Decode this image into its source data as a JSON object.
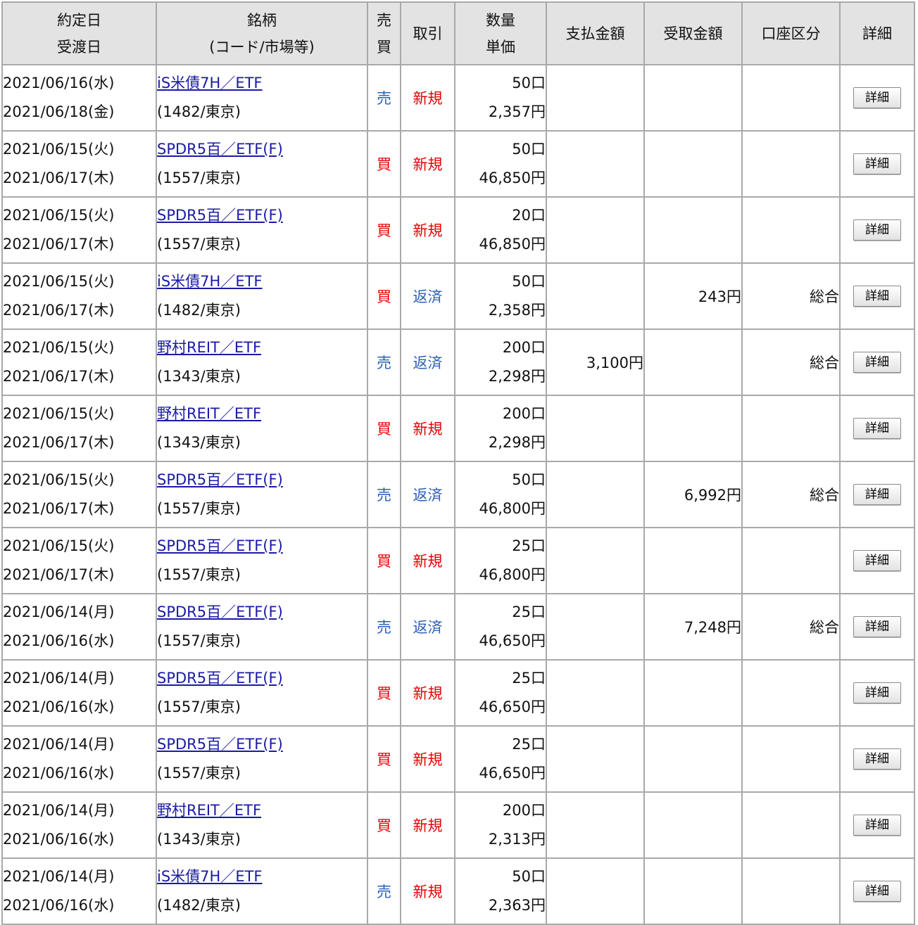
{
  "header": {
    "col1": [
      "約定日",
      "受渡日"
    ],
    "col2": [
      "銘柄",
      "(コード/市場等)"
    ],
    "col3": [
      "売",
      "買"
    ],
    "col4": "取引",
    "col5": [
      "数量",
      "単価"
    ],
    "col6": "支払金額",
    "col7": "受取金額",
    "col8": "口座区分",
    "col9": "詳細"
  },
  "detail_button_label": "詳細",
  "colors": {
    "sell": "#2a5fb7",
    "buy": "#e60000",
    "new": "#e60000",
    "close": "#2a5fb7"
  },
  "rows": [
    {
      "trade_date": "2021/06/16(水)",
      "settle_date": "2021/06/18(金)",
      "name": "iS米債7H／ETF",
      "code": "(1482/東京)",
      "side": "売",
      "kind": "新規",
      "qty": "50口",
      "price": "2,357円",
      "pay": "",
      "receive": "",
      "account": ""
    },
    {
      "trade_date": "2021/06/15(火)",
      "settle_date": "2021/06/17(木)",
      "name": "SPDR5百／ETF(F)",
      "code": "(1557/東京)",
      "side": "買",
      "kind": "新規",
      "qty": "50口",
      "price": "46,850円",
      "pay": "",
      "receive": "",
      "account": ""
    },
    {
      "trade_date": "2021/06/15(火)",
      "settle_date": "2021/06/17(木)",
      "name": "SPDR5百／ETF(F)",
      "code": "(1557/東京)",
      "side": "買",
      "kind": "新規",
      "qty": "20口",
      "price": "46,850円",
      "pay": "",
      "receive": "",
      "account": ""
    },
    {
      "trade_date": "2021/06/15(火)",
      "settle_date": "2021/06/17(木)",
      "name": "iS米債7H／ETF",
      "code": "(1482/東京)",
      "side": "買",
      "kind": "返済",
      "qty": "50口",
      "price": "2,358円",
      "pay": "",
      "receive": "243円",
      "account": "総合"
    },
    {
      "trade_date": "2021/06/15(火)",
      "settle_date": "2021/06/17(木)",
      "name": "野村REIT／ETF",
      "code": "(1343/東京)",
      "side": "売",
      "kind": "返済",
      "qty": "200口",
      "price": "2,298円",
      "pay": "3,100円",
      "receive": "",
      "account": "総合"
    },
    {
      "trade_date": "2021/06/15(火)",
      "settle_date": "2021/06/17(木)",
      "name": "野村REIT／ETF",
      "code": "(1343/東京)",
      "side": "買",
      "kind": "新規",
      "qty": "200口",
      "price": "2,298円",
      "pay": "",
      "receive": "",
      "account": ""
    },
    {
      "trade_date": "2021/06/15(火)",
      "settle_date": "2021/06/17(木)",
      "name": "SPDR5百／ETF(F)",
      "code": "(1557/東京)",
      "side": "売",
      "kind": "返済",
      "qty": "50口",
      "price": "46,800円",
      "pay": "",
      "receive": "6,992円",
      "account": "総合"
    },
    {
      "trade_date": "2021/06/15(火)",
      "settle_date": "2021/06/17(木)",
      "name": "SPDR5百／ETF(F)",
      "code": "(1557/東京)",
      "side": "買",
      "kind": "新規",
      "qty": "25口",
      "price": "46,800円",
      "pay": "",
      "receive": "",
      "account": ""
    },
    {
      "trade_date": "2021/06/14(月)",
      "settle_date": "2021/06/16(水)",
      "name": "SPDR5百／ETF(F)",
      "code": "(1557/東京)",
      "side": "売",
      "kind": "返済",
      "qty": "25口",
      "price": "46,650円",
      "pay": "",
      "receive": "7,248円",
      "account": "総合"
    },
    {
      "trade_date": "2021/06/14(月)",
      "settle_date": "2021/06/16(水)",
      "name": "SPDR5百／ETF(F)",
      "code": "(1557/東京)",
      "side": "買",
      "kind": "新規",
      "qty": "25口",
      "price": "46,650円",
      "pay": "",
      "receive": "",
      "account": ""
    },
    {
      "trade_date": "2021/06/14(月)",
      "settle_date": "2021/06/16(水)",
      "name": "SPDR5百／ETF(F)",
      "code": "(1557/東京)",
      "side": "買",
      "kind": "新規",
      "qty": "25口",
      "price": "46,650円",
      "pay": "",
      "receive": "",
      "account": ""
    },
    {
      "trade_date": "2021/06/14(月)",
      "settle_date": "2021/06/16(水)",
      "name": "野村REIT／ETF",
      "code": "(1343/東京)",
      "side": "買",
      "kind": "新規",
      "qty": "200口",
      "price": "2,313円",
      "pay": "",
      "receive": "",
      "account": ""
    },
    {
      "trade_date": "2021/06/14(月)",
      "settle_date": "2021/06/16(水)",
      "name": "iS米債7H／ETF",
      "code": "(1482/東京)",
      "side": "売",
      "kind": "新規",
      "qty": "50口",
      "price": "2,363円",
      "pay": "",
      "receive": "",
      "account": ""
    }
  ]
}
